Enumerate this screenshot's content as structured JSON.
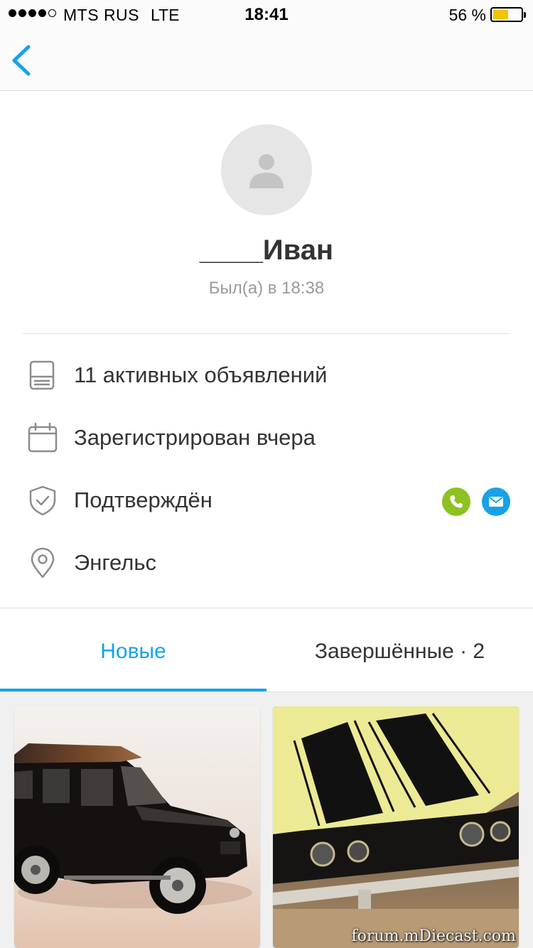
{
  "status_bar": {
    "carrier": "MTS RUS",
    "network": "LTE",
    "time": "18:41",
    "battery_percent": "56 %",
    "battery_level": 0.56,
    "signal_bars": 4
  },
  "nav": {
    "back_icon": "chevron-left-icon"
  },
  "profile": {
    "name": "____Иван",
    "last_seen": "Был(а) в 18:38"
  },
  "info": {
    "active_ads": "11 активных объявлений",
    "registered": "Зарегистрирован вчера",
    "verified": "Подтверждён",
    "city": "Энгельс"
  },
  "tabs": {
    "new_label": "Новые",
    "done_label": "Завершённые · 2",
    "active": "new"
  },
  "listings": [
    {
      "image": "black-suv-model-photo"
    },
    {
      "image": "yellow-muscle-car-model-photo",
      "watermark": "forum.mDiecast.com"
    }
  ],
  "colors": {
    "accent": "#17a2e8",
    "phone": "#8cc21f",
    "text": "#333333",
    "muted": "#9a9a9a",
    "icon_gray": "#8c8c8c"
  }
}
